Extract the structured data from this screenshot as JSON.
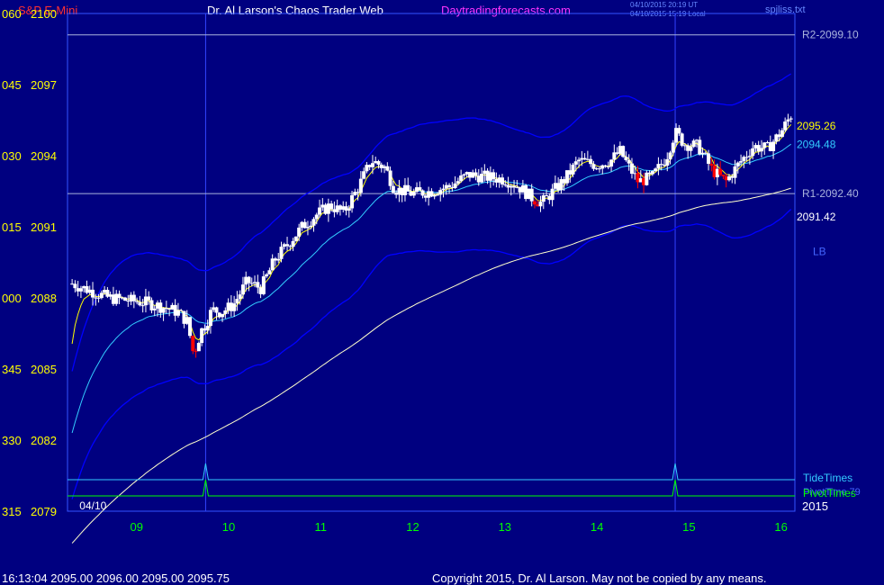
{
  "header": {
    "symbol": "S&P E-Mini",
    "title": "Dr. Al Larson's Chaos Trader Web",
    "site": "Daytradingforecasts.com",
    "stamp_line1": "04/10/2015 20:19 UT",
    "stamp_line2": "04/10/2015 15:19 Local",
    "file": "spjliss.txt"
  },
  "footer": {
    "quote": "16:13:04  2095.00 2096.00 2095.00 2095.75",
    "copyright": "Copyright 2015, Dr. Al Larson. May not be copied by any means."
  },
  "colors": {
    "background": "#000080",
    "plot_border": "#3355ff",
    "up_candle": "#ffffff",
    "down_candle": "#ff0000",
    "ema_fast": "#ffff00",
    "ema_mid": "#33ccff",
    "ema_slow": "#ffffcc",
    "band": "#0000ff",
    "level_line": "#aab4dd",
    "axis_text": "#ffff00",
    "date_text": "#00ff00",
    "tide": "#33ccff",
    "pivot": "#00ff00"
  },
  "chart_data": {
    "type": "candlestick",
    "y_ticks": [
      {
        "price": 2100,
        "label": "2100",
        "code": "060"
      },
      {
        "price": 2097,
        "label": "2097",
        "code": "045"
      },
      {
        "price": 2094,
        "label": "2094",
        "code": "030"
      },
      {
        "price": 2091,
        "label": "2091",
        "code": "015"
      },
      {
        "price": 2088,
        "label": "2088",
        "code": "000"
      },
      {
        "price": 2085,
        "label": "2085",
        "code": "345"
      },
      {
        "price": 2082,
        "label": "2082",
        "code": "330"
      },
      {
        "price": 2079,
        "label": "2079",
        "code": "315"
      }
    ],
    "ylim": [
      2079,
      2100
    ],
    "x_ticks": [
      "09",
      "10",
      "11",
      "12",
      "13",
      "14",
      "15",
      "16"
    ],
    "xlim": [
      8.25,
      16.15
    ],
    "date_label": "04/10",
    "year_label": "2015",
    "levels": [
      {
        "name": "R2",
        "price": 2099.1,
        "label": "R2-2099.10"
      },
      {
        "name": "R1",
        "price": 2092.4,
        "label": "R1-2092.40"
      }
    ],
    "last_values": [
      {
        "series": "ema_fast",
        "value": "2095.26"
      },
      {
        "series": "ema_mid",
        "value": "2094.48"
      },
      {
        "series": "ema_slow",
        "value": "2091.42"
      }
    ],
    "band_label": "LB",
    "timing_lines": [
      {
        "name": "TideTimes",
        "label": "TideTimes",
        "peaks_at": [
          9.75,
          14.85
        ]
      },
      {
        "name": "PivotTimes",
        "label": "PivotTimes",
        "peaks_at": [
          9.75,
          14.85
        ]
      }
    ],
    "overlap_label": "PivotTime 79",
    "vertical_markers": [
      9.75,
      14.85
    ],
    "anchors": [
      [
        8.3,
        2088.6
      ],
      [
        8.5,
        2088.3
      ],
      [
        8.7,
        2088.0
      ],
      [
        8.9,
        2087.9
      ],
      [
        9.1,
        2087.8
      ],
      [
        9.3,
        2087.6
      ],
      [
        9.45,
        2087.4
      ],
      [
        9.55,
        2087.0
      ],
      [
        9.62,
        2085.6
      ],
      [
        9.7,
        2086.6
      ],
      [
        9.75,
        2086.9
      ],
      [
        9.82,
        2087.5
      ],
      [
        9.92,
        2087.4
      ],
      [
        10.05,
        2087.7
      ],
      [
        10.2,
        2088.7
      ],
      [
        10.35,
        2088.4
      ],
      [
        10.5,
        2089.6
      ],
      [
        10.65,
        2090.3
      ],
      [
        10.8,
        2091.0
      ],
      [
        10.95,
        2091.5
      ],
      [
        11.1,
        2091.9
      ],
      [
        11.25,
        2091.6
      ],
      [
        11.4,
        2092.6
      ],
      [
        11.55,
        2093.8
      ],
      [
        11.7,
        2093.5
      ],
      [
        11.8,
        2092.6
      ],
      [
        12.0,
        2092.4
      ],
      [
        12.2,
        2092.5
      ],
      [
        12.4,
        2092.7
      ],
      [
        12.6,
        2093.2
      ],
      [
        12.8,
        2093.1
      ],
      [
        13.0,
        2093.0
      ],
      [
        13.15,
        2092.7
      ],
      [
        13.3,
        2092.2
      ],
      [
        13.4,
        2092.0
      ],
      [
        13.5,
        2092.4
      ],
      [
        13.65,
        2093.0
      ],
      [
        13.8,
        2093.8
      ],
      [
        14.0,
        2093.6
      ],
      [
        14.15,
        2093.8
      ],
      [
        14.25,
        2094.2
      ],
      [
        14.35,
        2093.5
      ],
      [
        14.45,
        2092.9
      ],
      [
        14.6,
        2093.1
      ],
      [
        14.75,
        2093.9
      ],
      [
        14.85,
        2095.0
      ],
      [
        14.95,
        2094.5
      ],
      [
        15.1,
        2094.4
      ],
      [
        15.25,
        2093.4
      ],
      [
        15.4,
        2092.9
      ],
      [
        15.55,
        2093.7
      ],
      [
        15.7,
        2094.4
      ],
      [
        15.85,
        2094.3
      ],
      [
        16.0,
        2095.0
      ],
      [
        16.12,
        2095.8
      ]
    ],
    "red_candle_zones": [
      [
        9.6,
        9.7
      ],
      [
        13.3,
        13.42
      ],
      [
        14.4,
        14.52
      ],
      [
        15.22,
        15.45
      ]
    ]
  }
}
